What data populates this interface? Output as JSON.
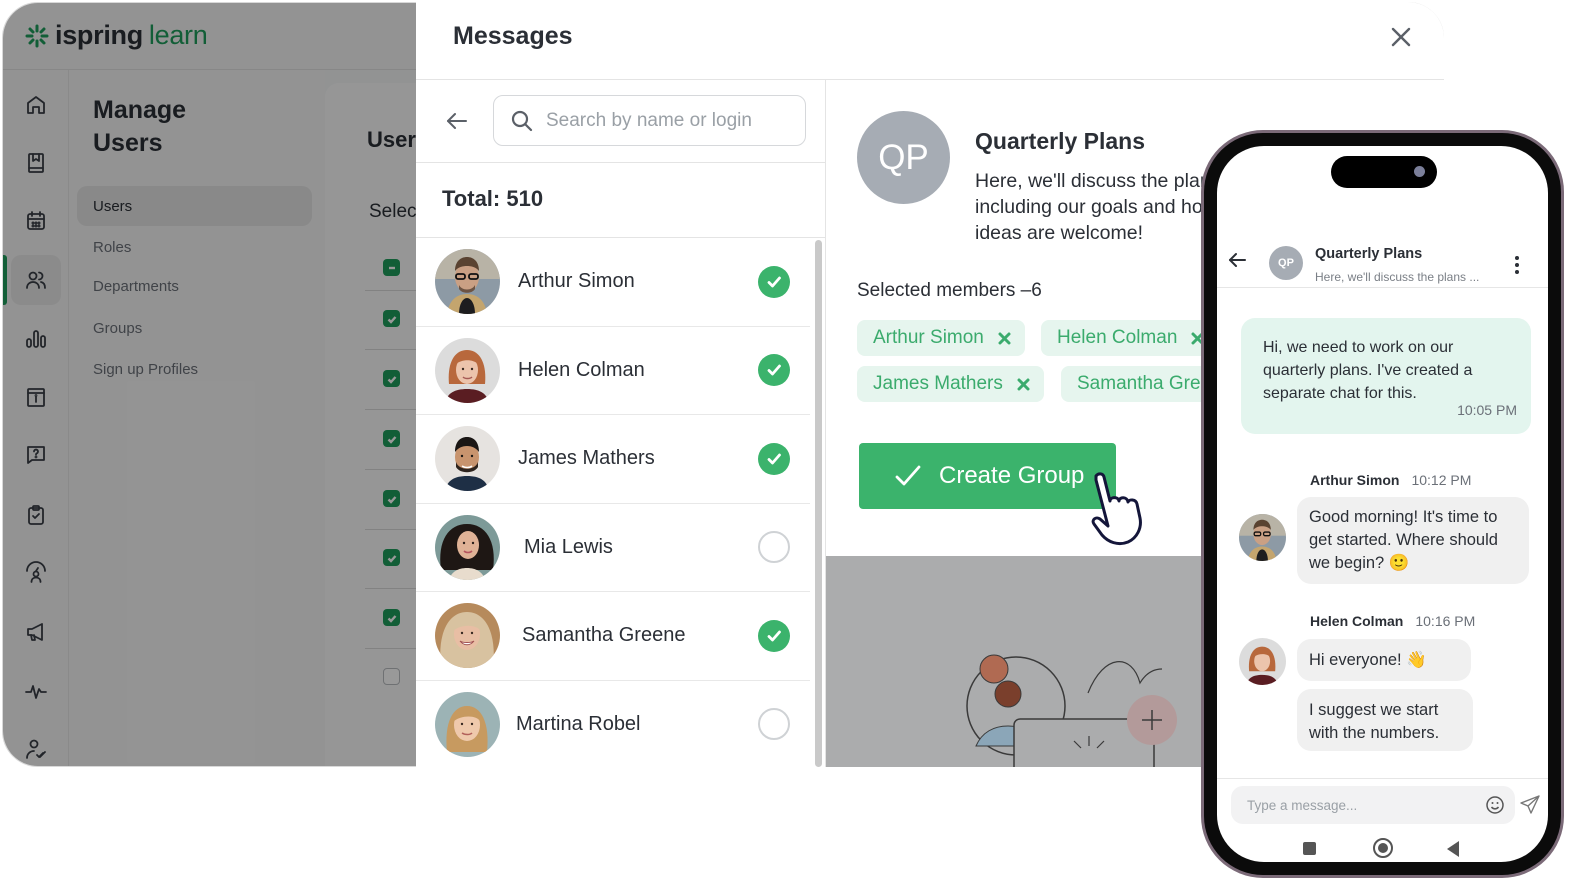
{
  "app": {
    "logo_word1": "ispring",
    "logo_word2": "learn",
    "brand_color": "#1f9d5c",
    "rail_icons": [
      "home-icon",
      "book-icon",
      "calendar-icon",
      "users-icon",
      "bar-chart-icon",
      "info-book-icon",
      "question-bubble-icon",
      "clipboard-check-icon",
      "user-gauge-icon",
      "megaphone-icon",
      "pulse-icon",
      "user-check-icon"
    ],
    "rail_active_index": 3,
    "section_title": "Manage Users",
    "nav_items": [
      {
        "label": "Users",
        "active": true
      },
      {
        "label": "Roles",
        "active": false
      },
      {
        "label": "Departments",
        "active": false
      },
      {
        "label": "Groups",
        "active": false
      },
      {
        "label": "Sign up Profiles",
        "active": false
      }
    ],
    "content_title": "Users",
    "content_select_label": "Select",
    "table_checkboxes": [
      "indeterminate",
      "checked",
      "checked",
      "checked",
      "checked",
      "checked",
      "checked",
      "unchecked"
    ]
  },
  "modal": {
    "title": "Messages",
    "search_placeholder": "Search by name or login",
    "search_value": "",
    "total_label": "Total: 510",
    "users": [
      {
        "name": "Arthur Simon",
        "selected": true
      },
      {
        "name": "Helen Colman",
        "selected": true
      },
      {
        "name": "James Mathers",
        "selected": true
      },
      {
        "name": "Mia Lewis",
        "selected": false
      },
      {
        "name": "Samantha Greene",
        "selected": true
      },
      {
        "name": "Martina Robel",
        "selected": false
      }
    ],
    "group": {
      "initials": "QP",
      "name": "Quarterly Plans",
      "description": "Here, we'll discuss the plans, including our goals and how... ideas are welcome!",
      "description_lines": [
        "Here, we'll discuss the plan",
        "including our goals and ho",
        "ideas are welcome!"
      ]
    },
    "selected_label": "Selected members –6",
    "chips": [
      "Arthur Simon",
      "Helen Colman",
      "James Mathers",
      "Samantha Greene"
    ],
    "create_button": "Create Group",
    "accent_color": "#3bb36c"
  },
  "phone": {
    "chat_initials": "QP",
    "chat_title": "Quarterly Plans",
    "chat_subtitle": "Here, we'll discuss the plans ...",
    "messages": [
      {
        "type": "outgoing",
        "text": "Hi, we need to work on our quarterly plans. I've created a separate chat for this.",
        "time": "10:05 PM"
      },
      {
        "type": "incoming",
        "sender": "Arthur Simon",
        "time": "10:12 PM",
        "texts": [
          "Good morning! It's time to get started. Where should we begin? 🙂"
        ]
      },
      {
        "type": "incoming",
        "sender": "Helen Colman",
        "time": "10:16 PM",
        "texts": [
          "Hi everyone! 👋",
          "I suggest we start with the numbers."
        ]
      }
    ],
    "composer_placeholder": "Type a message..."
  }
}
